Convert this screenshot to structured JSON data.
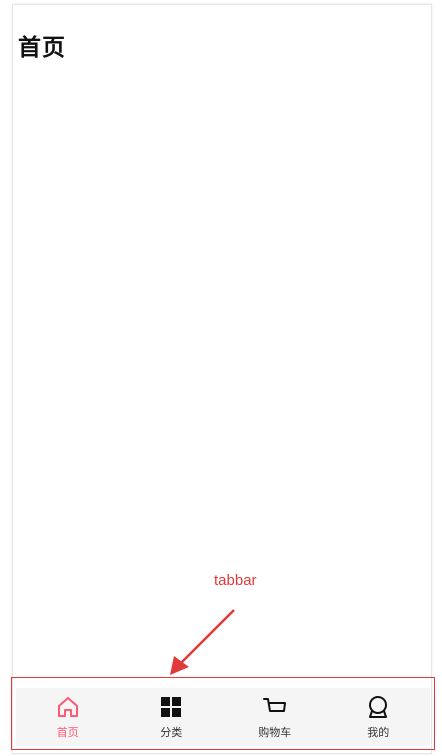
{
  "page": {
    "title": "首页"
  },
  "annotation": {
    "label": "tabbar"
  },
  "colors": {
    "accent": "#ff5a75",
    "annotation": "#e03a3a",
    "tabbar_bg": "#f5f5f5"
  },
  "tabbar": {
    "items": [
      {
        "label": "首页",
        "icon": "home-icon",
        "active": true
      },
      {
        "label": "分类",
        "icon": "grid-icon",
        "active": false
      },
      {
        "label": "购物车",
        "icon": "cart-icon",
        "active": false
      },
      {
        "label": "我的",
        "icon": "profile-icon",
        "active": false
      }
    ]
  }
}
